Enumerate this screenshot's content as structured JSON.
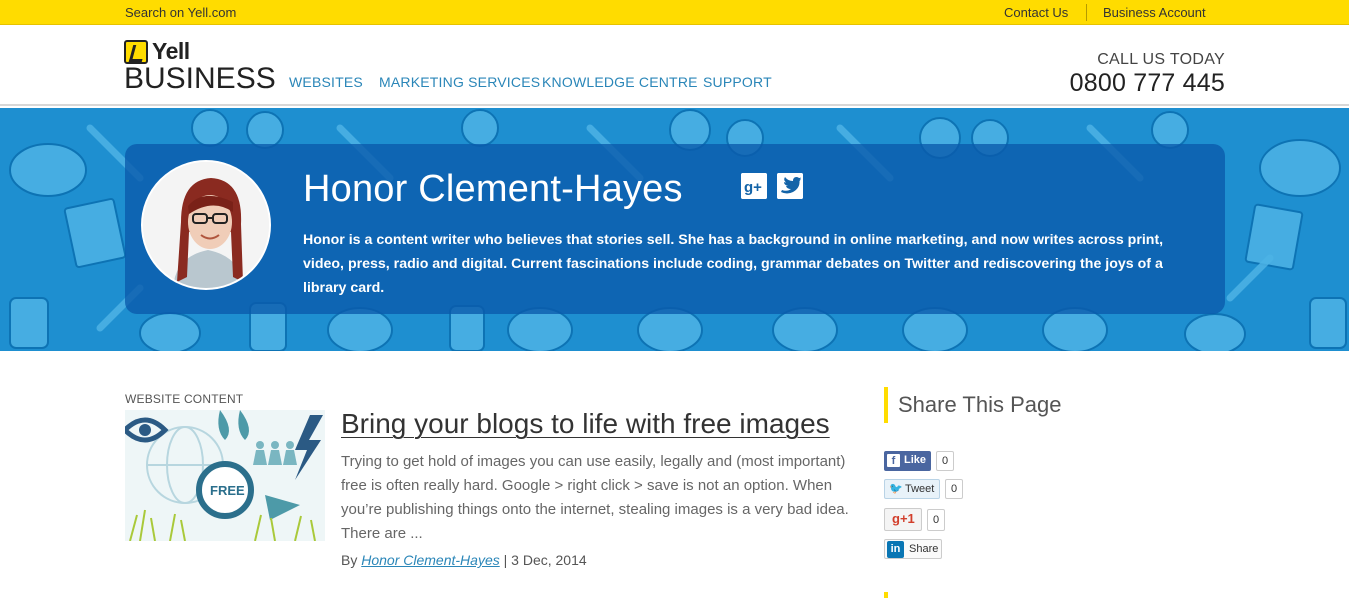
{
  "topbar": {
    "search_link": "Search on Yell.com",
    "contact_link": "Contact Us",
    "business_link": "Business Account"
  },
  "header": {
    "logo_top": "Yell",
    "logo_bottom": "BUSINESS",
    "nav": [
      "WEBSITES",
      "MARKETING SERVICES",
      "KNOWLEDGE CENTRE",
      "SUPPORT"
    ],
    "call_label": "CALL US TODAY",
    "phone": "0800 777 445"
  },
  "author": {
    "name": "Honor Clement-Hayes",
    "bio": "Honor is a content writer who believes that stories sell. She has a background in online marketing, and now writes across print, video, press, radio and digital. Current fascinations include coding, grammar debates on Twitter and rediscovering the joys of a library card."
  },
  "article": {
    "category": "WEBSITE CONTENT",
    "thumb_badge": "FREE",
    "title": "Bring your blogs to life with free images",
    "excerpt": "Trying to get hold of images you can use easily, legally and (most important) free is often really hard. Google > right click > save is not an option. When you’re publishing things onto the internet, stealing images is a very bad idea. There are ...",
    "by_label": "By",
    "author_link": "Honor Clement-Hayes",
    "date": "| 3 Dec, 2014"
  },
  "share": {
    "heading": "Share This Page",
    "like_label": "Like",
    "like_count": "0",
    "tweet_label": "Tweet",
    "tweet_count": "0",
    "gplus_label": "g+1",
    "gplus_count": "0",
    "linkedin_label": "Share"
  },
  "colors": {
    "brand_yellow": "#ffdc00",
    "hero_blue": "#1e8fd0",
    "link_blue": "#2a86b8"
  }
}
